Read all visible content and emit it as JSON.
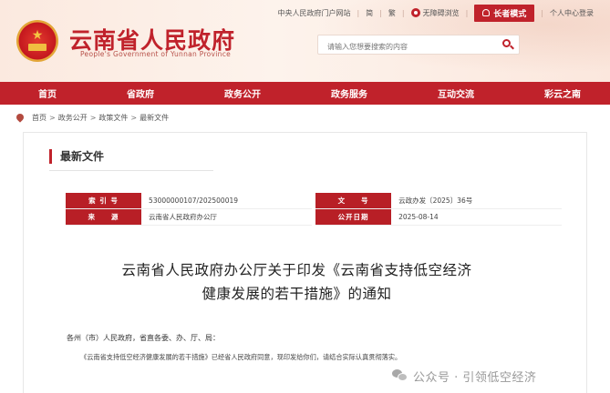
{
  "topbar": {
    "central_portal": "中央人民政府门户网站",
    "simplified": "简",
    "traditional": "繁",
    "accessibility": "无障碍浏览",
    "elder_mode": "长者模式",
    "personal_center": "个人中心登录"
  },
  "header": {
    "site_title": "云南省人民政府",
    "site_subtitle": "People's Government of Yunnan Province",
    "search_placeholder": "请输入您想要搜索的内容"
  },
  "nav": {
    "items": [
      "首页",
      "省政府",
      "政务公开",
      "政务服务",
      "互动交流",
      "彩云之南"
    ]
  },
  "breadcrumb": {
    "items": [
      "首页",
      "政务公开",
      "政策文件",
      "最新文件"
    ]
  },
  "section": {
    "title": "最新文件"
  },
  "meta": {
    "index_label": "索 引 号",
    "index_value": "53000000107/202500019",
    "doc_no_label": "文　　号",
    "doc_no_value": "云政办发〔2025〕36号",
    "source_label": "来　　源",
    "source_value": "云南省人民政府办公厅",
    "date_label": "公开日期",
    "date_value": "2025-08-14"
  },
  "document": {
    "title_line1": "云南省人民政府办公厅关于印发《云南省支持低空经济",
    "title_line2": "健康发展的若干措施》的通知",
    "addressee": "各州（市）人民政府，省直各委、办、厅、局：",
    "body": "《云南省支持低空经济健康发展的若干措施》已经省人民政府同意，现印发给你们，请结合实际认真贯彻落实。"
  },
  "watermark": {
    "text": "公众号 · 引领低空经济"
  },
  "colors": {
    "brand_red": "#c0222b",
    "header_bg": "#fbe9df"
  }
}
